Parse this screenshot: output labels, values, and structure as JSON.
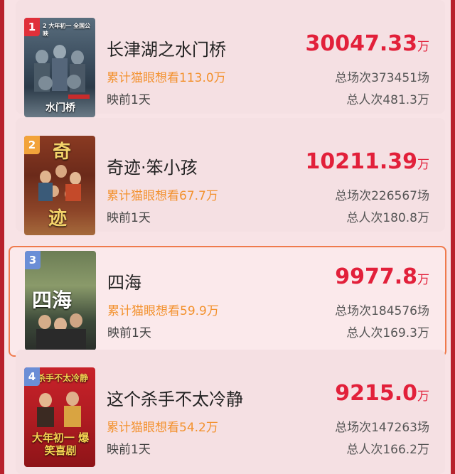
{
  "colors": {
    "background": "#b8212c",
    "accent_red": "#e2203a",
    "want_orange": "#f3912d",
    "highlight_border": "#ef7a4c",
    "rank_red": "#e0303a",
    "rank_orange": "#f2a33a",
    "rank_blue": "#6b8ed6"
  },
  "movies": [
    {
      "rank": "1",
      "title": "长津湖之水门桥",
      "want": "累计猫眼想看113.0万",
      "presale": "映前1天",
      "box_value": "30047.33",
      "box_unit": "万",
      "shows": "总场次373451场",
      "people": "总人次481.3万",
      "poster_top_text": "2 大年初一 全国公映",
      "poster_text": "水门桥"
    },
    {
      "rank": "2",
      "title": "奇迹·笨小孩",
      "want": "累计猫眼想看67.7万",
      "presale": "映前1天",
      "box_value": "10211.39",
      "box_unit": "万",
      "shows": "总场次226567场",
      "people": "总人次180.8万",
      "poster_top_text": "奇",
      "poster_text": "迹"
    },
    {
      "rank": "3",
      "title": "四海",
      "want": "累计猫眼想看59.9万",
      "presale": "映前1天",
      "box_value": "9977.8",
      "box_unit": "万",
      "shows": "总场次184576场",
      "people": "总人次169.3万",
      "poster_top_text": "",
      "poster_text": "四海"
    },
    {
      "rank": "4",
      "title": "这个杀手不太冷静",
      "want": "累计猫眼想看54.2万",
      "presale": "映前1天",
      "box_value": "9215.0",
      "box_unit": "万",
      "shows": "总场次147263场",
      "people": "总人次166.2万",
      "poster_top_text": "杀手不太冷静",
      "poster_text": "大年初一 爆笑喜剧"
    }
  ]
}
